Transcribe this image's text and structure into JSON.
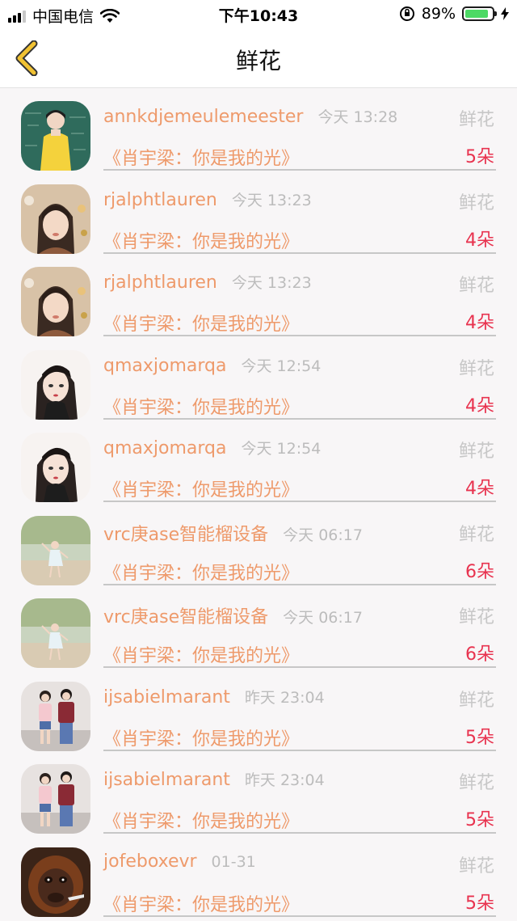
{
  "status_bar": {
    "carrier": "中国电信",
    "time": "下午10:43",
    "battery_percent": "89%",
    "battery_level": 0.89,
    "signal_bars_active": 3,
    "signal_bars_total": 4
  },
  "nav": {
    "title": "鲜花",
    "back_icon": "chevron-left-icon",
    "accent_color": "#f1c232"
  },
  "colors": {
    "username": "#ee9a6b",
    "time": "#bcbcbc",
    "category": "#c7c7c7",
    "count": "#e8334f"
  },
  "items": [
    {
      "user": "annkdjemeulemeester",
      "time": "今天 13:28",
      "category": "鲜花",
      "book": "《肖宇梁：你是我的光》",
      "count": "5朵",
      "avatar": "boy-yellow-hoodie"
    },
    {
      "user": "rjalphtlauren",
      "time": "今天 13:23",
      "category": "鲜花",
      "book": "《肖宇梁：你是我的光》",
      "count": "4朵",
      "avatar": "girl-bangs"
    },
    {
      "user": "rjalphtlauren",
      "time": "今天 13:23",
      "category": "鲜花",
      "book": "《肖宇梁：你是我的光》",
      "count": "4朵",
      "avatar": "girl-bangs"
    },
    {
      "user": "qmaxjomarqa",
      "time": "今天 12:54",
      "category": "鲜花",
      "book": "《肖宇梁：你是我的光》",
      "count": "4朵",
      "avatar": "anime-girl"
    },
    {
      "user": "qmaxjomarqa",
      "time": "今天 12:54",
      "category": "鲜花",
      "book": "《肖宇梁：你是我的光》",
      "count": "4朵",
      "avatar": "anime-girl"
    },
    {
      "user": "vrc庚ase智能榴设备",
      "time": "今天 06:17",
      "category": "鲜花",
      "book": "《肖宇梁：你是我的光》",
      "count": "6朵",
      "avatar": "girl-outdoor"
    },
    {
      "user": "vrc庚ase智能榴设备",
      "time": "今天 06:17",
      "category": "鲜花",
      "book": "《肖宇梁：你是我的光》",
      "count": "6朵",
      "avatar": "girl-outdoor"
    },
    {
      "user": "ijsabielmarant",
      "time": "昨天 23:04",
      "category": "鲜花",
      "book": "《肖宇梁：你是我的光》",
      "count": "5朵",
      "avatar": "couple"
    },
    {
      "user": "ijsabielmarant",
      "time": "昨天 23:04",
      "category": "鲜花",
      "book": "《肖宇梁：你是我的光》",
      "count": "5朵",
      "avatar": "couple"
    },
    {
      "user": "jofeboxevr",
      "time": "01-31",
      "category": "鲜花",
      "book": "《肖宇梁：你是我的光》",
      "count": "5朵",
      "avatar": "orangutan"
    }
  ]
}
